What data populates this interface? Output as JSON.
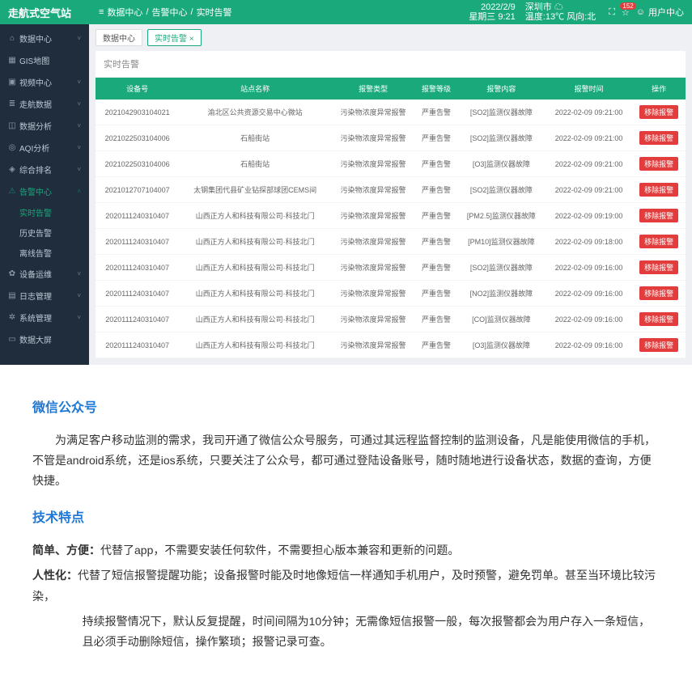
{
  "topbar": {
    "logo": "走航式空气站",
    "menu_icon": "≡",
    "crumbs": [
      "数据中心",
      "告警中心",
      "实时告警"
    ],
    "date": "2022/2/9",
    "weekday": "星期三 9:21",
    "city": "深圳市 ☁",
    "weather": "温度:13℃ 风向:北",
    "fullscreen": "⛶",
    "bell": "☆",
    "bell_badge": "152",
    "user": "用户中心"
  },
  "sidebar": [
    {
      "icon": "⌂",
      "label": "数据中心",
      "caret": "˅"
    },
    {
      "icon": "▦",
      "label": "GIS地图"
    },
    {
      "icon": "▣",
      "label": "视频中心",
      "caret": "˅"
    },
    {
      "icon": "≣",
      "label": "走航数据",
      "caret": "˅"
    },
    {
      "icon": "◫",
      "label": "数据分析",
      "caret": "˅"
    },
    {
      "icon": "◎",
      "label": "AQI分析",
      "caret": "˅"
    },
    {
      "icon": "◈",
      "label": "综合排名",
      "caret": "˅"
    },
    {
      "icon": "⚠",
      "label": "告警中心",
      "caret": "˄",
      "active": true,
      "children": [
        {
          "label": "实时告警",
          "active": true
        },
        {
          "label": "历史告警"
        },
        {
          "label": "离线告警"
        }
      ]
    },
    {
      "icon": "✿",
      "label": "设备运维",
      "caret": "˅"
    },
    {
      "icon": "▤",
      "label": "日志管理",
      "caret": "˅"
    },
    {
      "icon": "✲",
      "label": "系统管理",
      "caret": "˅"
    },
    {
      "icon": "▭",
      "label": "数据大屏"
    }
  ],
  "tabs": [
    {
      "label": "数据中心"
    },
    {
      "label": "实时告警 ×",
      "active": true
    }
  ],
  "panel_title": "实时告警",
  "columns": [
    "设备号",
    "站点名称",
    "报警类型",
    "报警等级",
    "报警内容",
    "报警时间",
    "操作"
  ],
  "rows": [
    {
      "c": [
        "2021042903104021",
        "渝北区公共资源交易中心微站",
        "污染物浓度异常报警",
        "严重告警",
        "[SO2]监测仪器故障",
        "2022-02-09 09:21:00"
      ]
    },
    {
      "c": [
        "2021022503104006",
        "石船街站",
        "污染物浓度异常报警",
        "严重告警",
        "[SO2]监测仪器故障",
        "2022-02-09 09:21:00"
      ]
    },
    {
      "c": [
        "2021022503104006",
        "石船街站",
        "污染物浓度异常报警",
        "严重告警",
        "[O3]监测仪器故障",
        "2022-02-09 09:21:00"
      ]
    },
    {
      "c": [
        "2021012707104007",
        "太钢集团代县矿业钻探部球团CEMS间",
        "污染物浓度异常报警",
        "严重告警",
        "[SO2]监测仪器故障",
        "2022-02-09 09:21:00"
      ]
    },
    {
      "c": [
        "2020111240310407",
        "山西正方人和科技有限公司·科技北门",
        "污染物浓度异常报警",
        "严重告警",
        "[PM2.5]监测仪器故障",
        "2022-02-09 09:19:00"
      ]
    },
    {
      "c": [
        "2020111240310407",
        "山西正方人和科技有限公司·科技北门",
        "污染物浓度异常报警",
        "严重告警",
        "[PM10]监测仪器故障",
        "2022-02-09 09:18:00"
      ]
    },
    {
      "c": [
        "2020111240310407",
        "山西正方人和科技有限公司·科技北门",
        "污染物浓度异常报警",
        "严重告警",
        "[SO2]监测仪器故障",
        "2022-02-09 09:16:00"
      ]
    },
    {
      "c": [
        "2020111240310407",
        "山西正方人和科技有限公司·科技北门",
        "污染物浓度异常报警",
        "严重告警",
        "[NO2]监测仪器故障",
        "2022-02-09 09:16:00"
      ]
    },
    {
      "c": [
        "2020111240310407",
        "山西正方人和科技有限公司·科技北门",
        "污染物浓度异常报警",
        "严重告警",
        "[CO]监测仪器故障",
        "2022-02-09 09:16:00"
      ]
    },
    {
      "c": [
        "2020111240310407",
        "山西正方人和科技有限公司·科技北门",
        "污染物浓度异常报警",
        "严重告警",
        "[O3]监测仪器故障",
        "2022-02-09 09:16:00"
      ]
    }
  ],
  "op_label": "移除报警",
  "article": {
    "h1": "微信公众号",
    "p1": "为满足客户移动监测的需求，我司开通了微信公众号服务，可通过其远程监督控制的监测设备，凡是能使用微信的手机，不管是android系统，还是ios系统，只要关注了公众号，都可通过登陆设备账号，随时随地进行设备状态，数据的查询，方便快捷。",
    "h2": "技术特点",
    "f1b": "简单、方便：",
    "f1": "代替了app，不需要安装任何软件，不需要担心版本兼容和更新的问题。",
    "f2b": "人性化：",
    "f2a": "代替了短信报警提醒功能；设备报警时能及时地像短信一样通知手机用户，及时预警，避免罚单。甚至当环境比较污染，",
    "f2c": "持续报警情况下，默认反复提醒，时间间隔为10分钟；无需像短信报警一般，每次报警都会为用户存入一条短信，且必须手动删除短信，操作繁琐；报警记录可查。"
  }
}
